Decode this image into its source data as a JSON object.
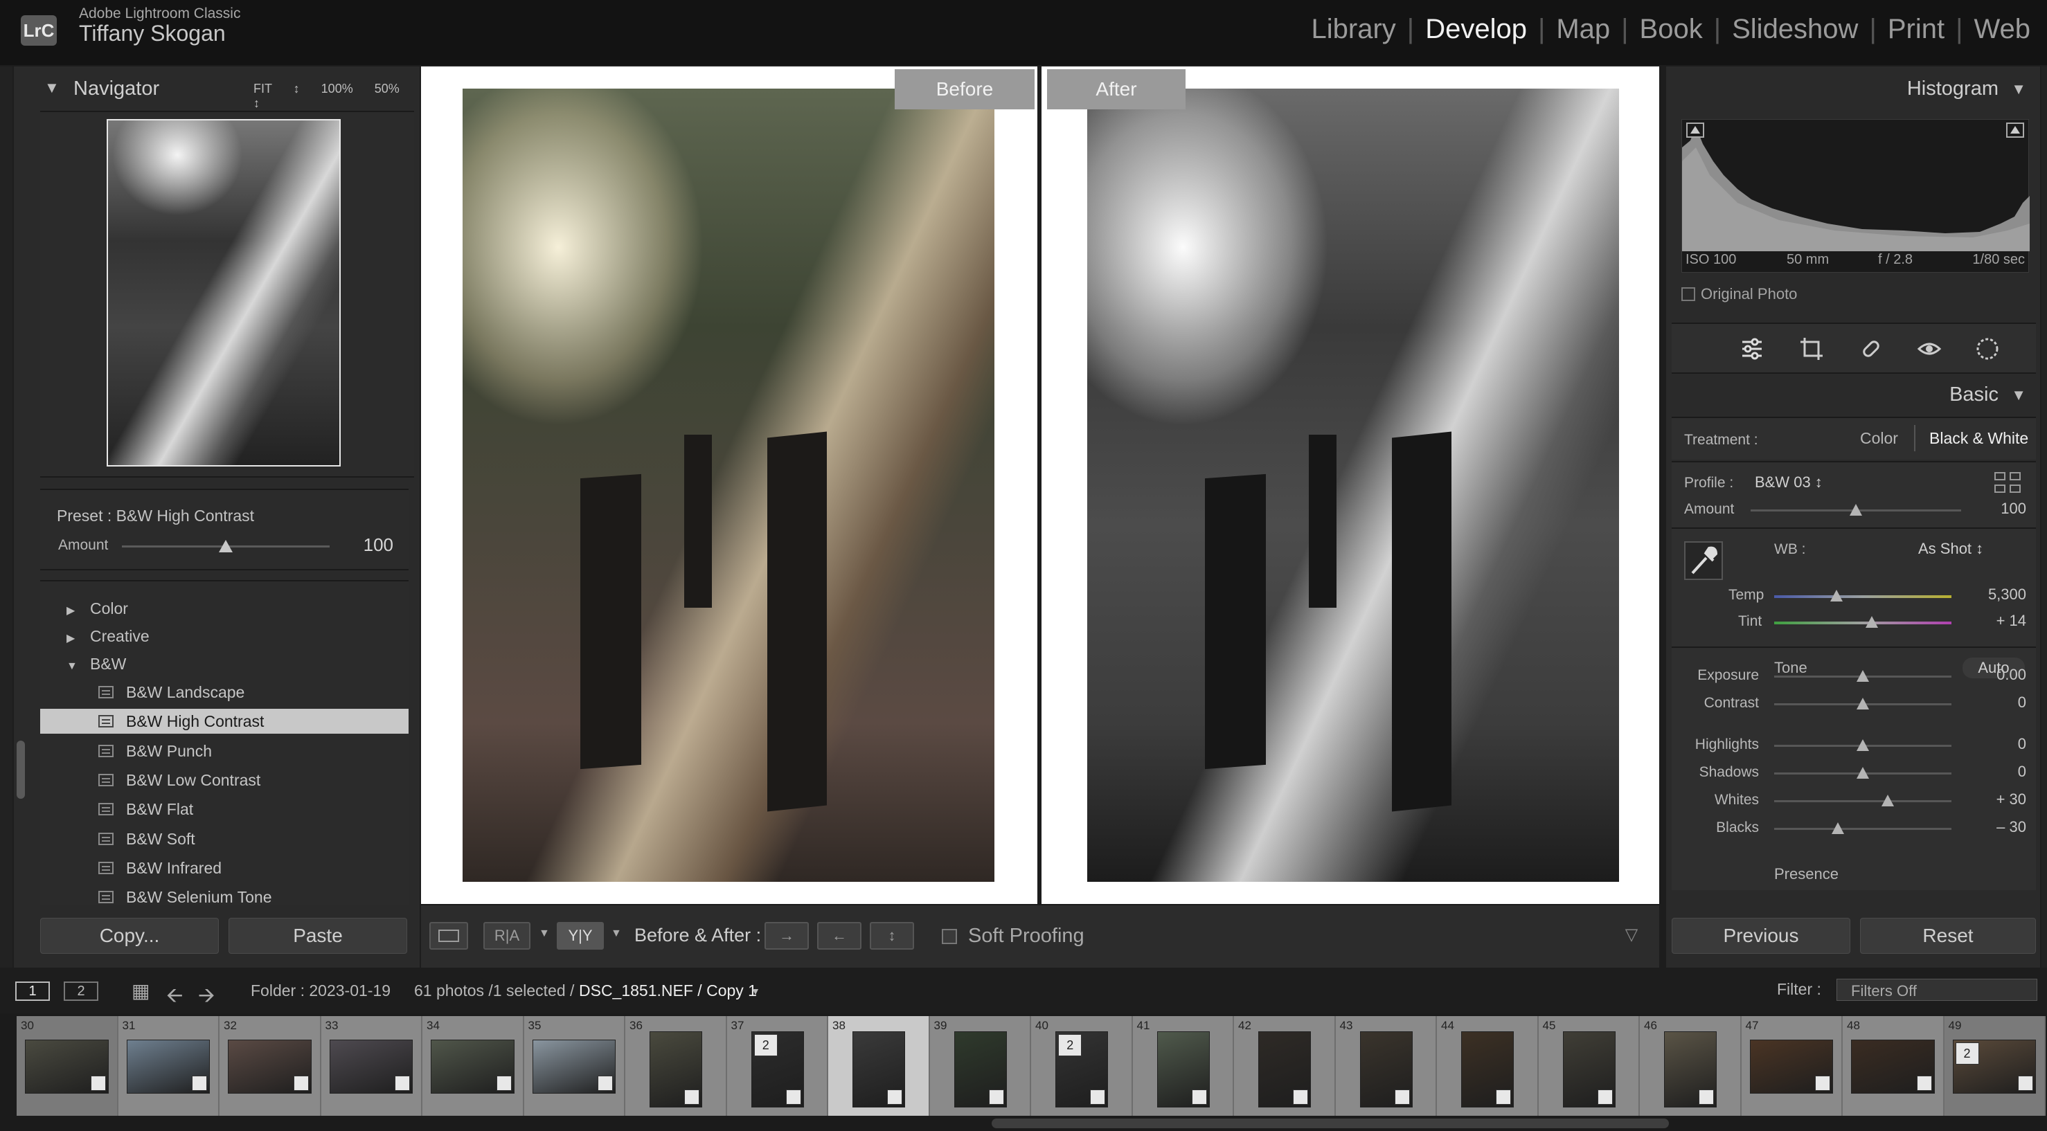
{
  "app": {
    "logo_text": "LrC",
    "name": "Adobe Lightroom Classic",
    "user": "Tiffany Skogan"
  },
  "modules": [
    "Library",
    "Develop",
    "Map",
    "Book",
    "Slideshow",
    "Print",
    "Web"
  ],
  "active_module": "Develop",
  "navigator": {
    "title": "Navigator",
    "zoom": "FIT ↕  100%  50% ↕"
  },
  "preset_box": {
    "label": "Preset : B&W High Contrast",
    "amount_label": "Amount",
    "amount_value": "100",
    "amount_fraction": 0.5
  },
  "presets": {
    "groups_collapsed": [
      "Color",
      "Creative"
    ],
    "group_open": "B&W",
    "items": [
      "B&W Landscape",
      "B&W High Contrast",
      "B&W Punch",
      "B&W Low Contrast",
      "B&W Flat",
      "B&W Soft",
      "B&W Infrared",
      "B&W Selenium Tone"
    ],
    "selected": "B&W High Contrast"
  },
  "left_buttons": {
    "copy": "Copy...",
    "paste": "Paste"
  },
  "view": {
    "before_label": "Before",
    "after_label": "After"
  },
  "toolbar": {
    "before_after": "Before & After :",
    "soft_proofing": "Soft Proofing",
    "ry_label": "R|A",
    "yy_label": "Y|Y"
  },
  "histogram": {
    "title": "Histogram",
    "iso": "ISO 100",
    "focal": "50 mm",
    "aperture": "f / 2.8",
    "shutter": "1/80 sec",
    "original_photo": "Original Photo"
  },
  "basic": {
    "title": "Basic",
    "treatment_label": "Treatment :",
    "treatment_color": "Color",
    "treatment_bw": "Black & White",
    "profile_label": "Profile :",
    "profile_value": "B&W 03 ↕",
    "amount_label": "Amount",
    "amount_value": "100",
    "amount_fraction": 0.5,
    "wb_label": "WB :",
    "wb_value": "As Shot ↕",
    "temp": {
      "label": "Temp",
      "value": "5,300",
      "fraction": 0.35
    },
    "tint": {
      "label": "Tint",
      "value": "+ 14",
      "fraction": 0.55
    },
    "tone_label": "Tone",
    "auto_label": "Auto",
    "sliders": [
      {
        "label": "Exposure",
        "value": "0.00",
        "fraction": 0.5
      },
      {
        "label": "Contrast",
        "value": "0",
        "fraction": 0.5
      },
      {
        "label": "Highlights",
        "value": "0",
        "fraction": 0.5
      },
      {
        "label": "Shadows",
        "value": "0",
        "fraction": 0.5
      },
      {
        "label": "Whites",
        "value": "+ 30",
        "fraction": 0.64
      },
      {
        "label": "Blacks",
        "value": "– 30",
        "fraction": 0.36
      }
    ],
    "presence_label": "Presence"
  },
  "right_buttons": {
    "previous": "Previous",
    "reset": "Reset"
  },
  "filmstrip_bar": {
    "page1": "1",
    "page2": "2",
    "folder": "Folder : 2023-01-19",
    "count": "61 photos /1 selected /",
    "file": "DSC_1851.NEF / Copy 1",
    "filter_label": "Filter :",
    "filter_value": "Filters Off"
  },
  "filmstrip": [
    {
      "num": "30",
      "tone": "#4a4a40",
      "orient": "land"
    },
    {
      "num": "31",
      "tone": "#6f8090",
      "orient": "land"
    },
    {
      "num": "32",
      "tone": "#5a4a44",
      "orient": "land"
    },
    {
      "num": "33",
      "tone": "#4e4a50",
      "orient": "land"
    },
    {
      "num": "34",
      "tone": "#50564a",
      "orient": "land"
    },
    {
      "num": "35",
      "tone": "#8a96a0",
      "orient": "land"
    },
    {
      "num": "36",
      "tone": "#4a4a3e",
      "orient": "port"
    },
    {
      "num": "37",
      "tone": "#2c2c2c",
      "orient": "port",
      "stack": "2"
    },
    {
      "num": "38",
      "tone": "#3a3a3a",
      "orient": "port"
    },
    {
      "num": "39",
      "tone": "#2f3a2c",
      "orient": "port"
    },
    {
      "num": "40",
      "tone": "#333333",
      "orient": "port",
      "stack": "2"
    },
    {
      "num": "41",
      "tone": "#505a4c",
      "orient": "port"
    },
    {
      "num": "42",
      "tone": "#2e2a26",
      "orient": "port"
    },
    {
      "num": "43",
      "tone": "#3a342c",
      "orient": "port"
    },
    {
      "num": "44",
      "tone": "#3c3024",
      "orient": "port"
    },
    {
      "num": "45",
      "tone": "#403e36",
      "orient": "port"
    },
    {
      "num": "46",
      "tone": "#5a5446",
      "orient": "port"
    },
    {
      "num": "47",
      "tone": "#4a3424",
      "orient": "land"
    },
    {
      "num": "48",
      "tone": "#3a2c22",
      "orient": "land"
    },
    {
      "num": "49",
      "tone": "#5a4a3a",
      "orient": "land",
      "stack": "2"
    }
  ],
  "filmstrip_selected": "38"
}
